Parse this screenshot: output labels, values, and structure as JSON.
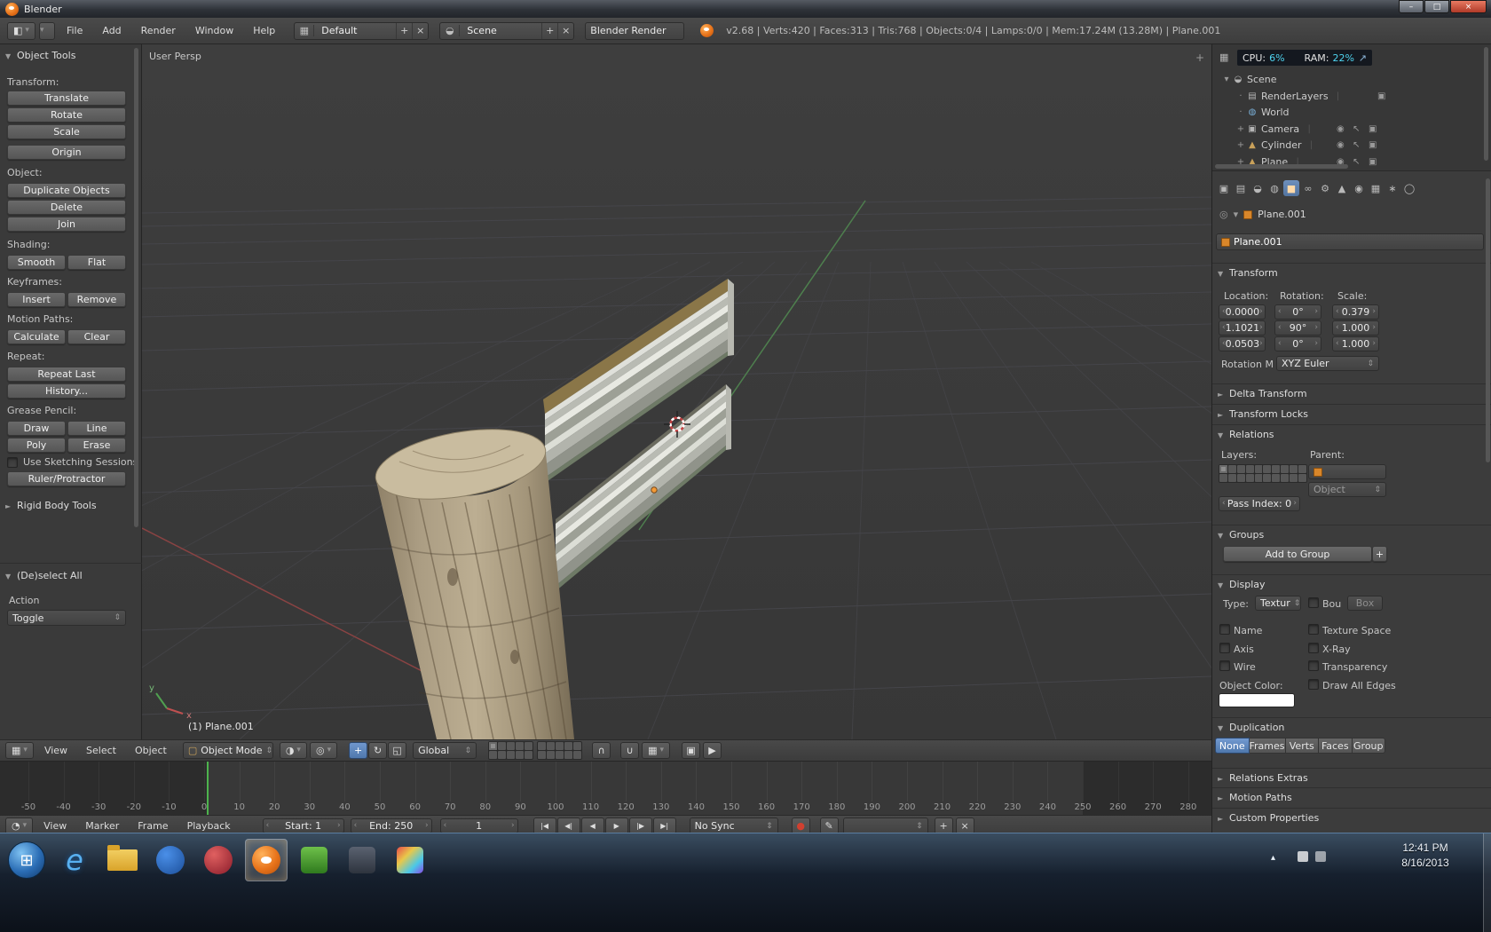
{
  "titlebar": {
    "title": "Blender"
  },
  "infobar": {
    "menus": [
      "File",
      "Add",
      "Render",
      "Window",
      "Help"
    ],
    "layout_value": "Default",
    "scene_value": "Scene",
    "engine_value": "Blender Render",
    "stats": "v2.68 | Verts:420 | Faces:313 | Tris:768 | Objects:0/4 | Lamps:0/0 | Mem:17.24M (13.28M) | Plane.001"
  },
  "tool_shelf": {
    "title": "Object Tools",
    "transform_label": "Transform:",
    "translate": "Translate",
    "rotate": "Rotate",
    "scale": "Scale",
    "origin": "Origin",
    "object_label": "Object:",
    "duplicate": "Duplicate Objects",
    "delete": "Delete",
    "join": "Join",
    "shading_label": "Shading:",
    "smooth": "Smooth",
    "flat": "Flat",
    "keyframes_label": "Keyframes:",
    "insert": "Insert",
    "remove": "Remove",
    "motion_paths_label": "Motion Paths:",
    "calculate": "Calculate",
    "clear": "Clear",
    "repeat_label": "Repeat:",
    "repeat_last": "Repeat Last",
    "history": "History...",
    "grease_label": "Grease Pencil:",
    "draw": "Draw",
    "line": "Line",
    "poly": "Poly",
    "erase": "Erase",
    "sketch_sessions": "Use Sketching Sessions",
    "ruler": "Ruler/Protractor",
    "rigid_body": "Rigid Body Tools",
    "deselect_title": "(De)select All",
    "action_label": "Action",
    "action_value": "Toggle"
  },
  "viewport": {
    "view_label": "User Persp",
    "object_label": "(1) Plane.001",
    "axis_x": "x",
    "axis_y": "y"
  },
  "view3d_header": {
    "menus": [
      "View",
      "Select",
      "Object"
    ],
    "mode_value": "Object Mode",
    "orientation_value": "Global"
  },
  "timeline": {
    "ticks": [
      -50,
      -40,
      -30,
      -20,
      -10,
      0,
      10,
      20,
      30,
      40,
      50,
      60,
      70,
      80,
      90,
      100,
      110,
      120,
      130,
      140,
      150,
      160,
      170,
      180,
      190,
      200,
      210,
      220,
      230,
      240,
      250,
      260,
      270,
      280
    ],
    "frame_start": 1,
    "frame_end": 250,
    "current_frame": 1,
    "menus": [
      "View",
      "Marker",
      "Frame",
      "Playback"
    ],
    "start_field": "Start: 1",
    "end_field": "End: 250",
    "frame_field": "1",
    "sync_value": "No Sync"
  },
  "outliner": {
    "gadget": {
      "cpu_label": "CPU:",
      "cpu_value": "6%",
      "ram_label": "RAM:",
      "ram_value": "22%"
    },
    "items": [
      {
        "label": "Scene"
      },
      {
        "label": "RenderLayers"
      },
      {
        "label": "World"
      },
      {
        "label": "Camera"
      },
      {
        "label": "Cylinder"
      },
      {
        "label": "Plane"
      }
    ]
  },
  "properties": {
    "breadcrumb": "Plane.001",
    "name_value": "Plane.001",
    "transform_title": "Transform",
    "location_label": "Location:",
    "rotation_label": "Rotation:",
    "scale_label": "Scale:",
    "location": [
      "0.0000",
      "1.1021",
      "0.0503"
    ],
    "rotation": [
      "0°",
      "90°",
      "0°"
    ],
    "scale": [
      "0.379",
      "1.000",
      "1.000"
    ],
    "rotation_mode_label": "Rotation M",
    "rotation_mode_value": "XYZ Euler",
    "delta_transform": "Delta Transform",
    "transform_locks": "Transform Locks",
    "relations_title": "Relations",
    "layers_label": "Layers:",
    "parent_label": "Parent:",
    "object_value": "Object",
    "pass_index": "Pass Index: 0",
    "groups_title": "Groups",
    "add_to_group": "Add to Group",
    "display_title": "Display",
    "type_label": "Type:",
    "type_value": "Textur",
    "bounds_label": "Bou",
    "box_label": "Box",
    "cb_name": "Name",
    "cb_texture_space": "Texture Space",
    "cb_axis": "Axis",
    "cb_xray": "X-Ray",
    "cb_wire": "Wire",
    "cb_transparency": "Transparency",
    "object_color_label": "Object Color:",
    "cb_draw_all_edges": "Draw All Edges",
    "object_color": "#ffffff",
    "duplication_title": "Duplication",
    "dup_options": [
      "None",
      "Frames",
      "Verts",
      "Faces",
      "Group"
    ],
    "dup_active": "None",
    "relations_extras": "Relations Extras",
    "motion_paths": "Motion Paths",
    "custom_properties": "Custom Properties"
  },
  "taskbar": {
    "time": "12:41 PM",
    "date": "8/16/2013",
    "icons": [
      "start",
      "internet-explorer",
      "file-explorer",
      "media-app",
      "red-app",
      "blender",
      "green-app",
      "dark-app",
      "photos-app"
    ]
  },
  "icons": {
    "tri_open": "▼",
    "tri_closed": "►",
    "caret": "▾",
    "updown": "⇕",
    "larr": "‹",
    "rarr": "›",
    "plus": "+",
    "win_min": "–",
    "win_max": "□",
    "win_close": "×",
    "editor_info": "◧",
    "editor_grid": "▦",
    "editor_clock": "◔",
    "mode_cube": "▢",
    "shading_sphere": "◑",
    "pivot": "◎",
    "manip_translate": "+",
    "manip_rotate": "↻",
    "manip_scale": "◱",
    "lock": "∩",
    "magnet": "∪",
    "snap_elem": "▦",
    "render_still": "▣",
    "render_anim": "▶",
    "jump_start": "|◀",
    "prev_key": "◀|",
    "play_rev": "◀",
    "play": "▶",
    "next_key": "|▶",
    "jump_end": "▶|",
    "record": "●",
    "pencil": "✎",
    "eye": "◉",
    "cursor_arrow": "↖",
    "camera_toggle": "▣",
    "pipe": "|",
    "pin": "◎",
    "tab_render": "▣",
    "tab_render_layers": "▤",
    "tab_scene": "◒",
    "tab_world": "◍",
    "tab_object": "■",
    "tab_constraints": "∞",
    "tab_modifiers": "⚙",
    "tab_data": "▲",
    "tab_material": "◉",
    "tab_texture": "▦",
    "tab_particles": "∗",
    "tab_physics": "◯",
    "out_scene": "◒",
    "out_layers": "▤",
    "out_world": "◍",
    "out_camera": "▣",
    "out_mesh": "▲",
    "expand_open": "▾",
    "expand_plus": "+",
    "dot": "·",
    "gadget_arrow": "↗",
    "tray_chevron": "▴",
    "start_flag": "⊞",
    "ie_e": "e"
  },
  "colors": {
    "accent_blue": "#5680c2",
    "cfra_green": "#4db34d",
    "cpu_cyan": "#4fd4f0",
    "blender_orange": "#e8731a"
  }
}
